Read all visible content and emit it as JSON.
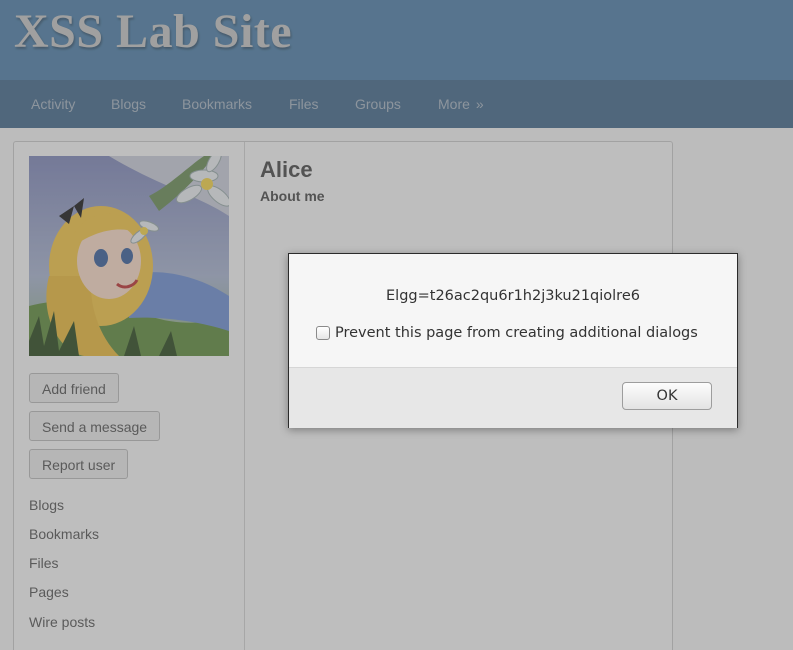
{
  "site": {
    "title": "XSS Lab Site"
  },
  "topbar": {
    "items": [
      {
        "label": "Activity"
      },
      {
        "label": "Blogs"
      },
      {
        "label": "Bookmarks"
      },
      {
        "label": "Files"
      },
      {
        "label": "Groups"
      },
      {
        "label": "More",
        "arrow": "»"
      }
    ]
  },
  "sidebar": {
    "buttons": [
      {
        "label": "Add friend"
      },
      {
        "label": "Send a message"
      },
      {
        "label": "Report user"
      }
    ],
    "links": [
      {
        "label": "Blogs"
      },
      {
        "label": "Bookmarks"
      },
      {
        "label": "Files"
      },
      {
        "label": "Pages"
      },
      {
        "label": "Wire posts"
      }
    ]
  },
  "profile": {
    "name": "Alice",
    "about_heading": "About me"
  },
  "dialog": {
    "message": "Elgg=t26ac2qu6r1h2j3ku21qiolre6",
    "checkbox_label": "Prevent this page from creating additional dialogs",
    "checkbox_checked": false,
    "ok_label": "OK"
  },
  "colors": {
    "header": "#4f7fa8",
    "topbar": "#44698c",
    "overlay": "rgba(100,100,100,0.38)"
  }
}
